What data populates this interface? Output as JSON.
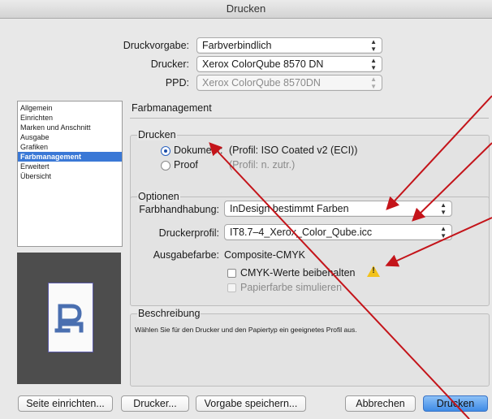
{
  "window": {
    "title": "Drucken"
  },
  "header_rows": [
    {
      "label": "Druckvorgabe:",
      "value": "Farbverbindlich",
      "disabled": false
    },
    {
      "label": "Drucker:",
      "value": "Xerox ColorQube 8570 DN",
      "disabled": false
    },
    {
      "label": "PPD:",
      "value": "Xerox ColorQube 8570DN",
      "disabled": true
    }
  ],
  "categories": {
    "items": [
      "Allgemein",
      "Einrichten",
      "Marken und Anschnitt",
      "Ausgabe",
      "Grafiken",
      "Farbmanagement",
      "Erweitert",
      "Übersicht"
    ],
    "selected": "Farbmanagement"
  },
  "section_title": "Farbmanagement",
  "print_group": {
    "title": "Drucken",
    "options": [
      {
        "label": "Dokument:",
        "detail": "(Profil: ISO Coated v2 (ECI))",
        "selected": true
      },
      {
        "label": "Proof",
        "detail": "(Profil: n. zutr.)",
        "selected": false
      }
    ]
  },
  "options_group": {
    "title": "Optionen",
    "color_handling_label": "Farbhandhabung:",
    "color_handling_value": "InDesign bestimmt Farben",
    "printer_profile_label": "Druckerprofil:",
    "printer_profile_value": "IT8.7–4_Xerox_Color_Qube.icc",
    "output_color_label": "Ausgabefarbe:",
    "output_color_value": "Composite-CMYK",
    "preserve_cmyk_label": "CMYK-Werte beibehalten",
    "paper_color_label": "Papierfarbe simulieren",
    "warning_icon": "warning-triangle-icon"
  },
  "description_group": {
    "title": "Beschreibung",
    "text": "Wählen Sie für den Drucker und den Papiertyp ein geeignetes Profil aus."
  },
  "buttons": {
    "page_setup": "Seite einrichten...",
    "printer": "Drucker...",
    "save_preset": "Vorgabe speichern...",
    "cancel": "Abbrechen",
    "print": "Drucken"
  },
  "preview": {
    "glyph": "P"
  },
  "colors": {
    "accent": "#3a78d6",
    "annotation_arrow": "#c4141a",
    "warning": "#f2c21b"
  }
}
